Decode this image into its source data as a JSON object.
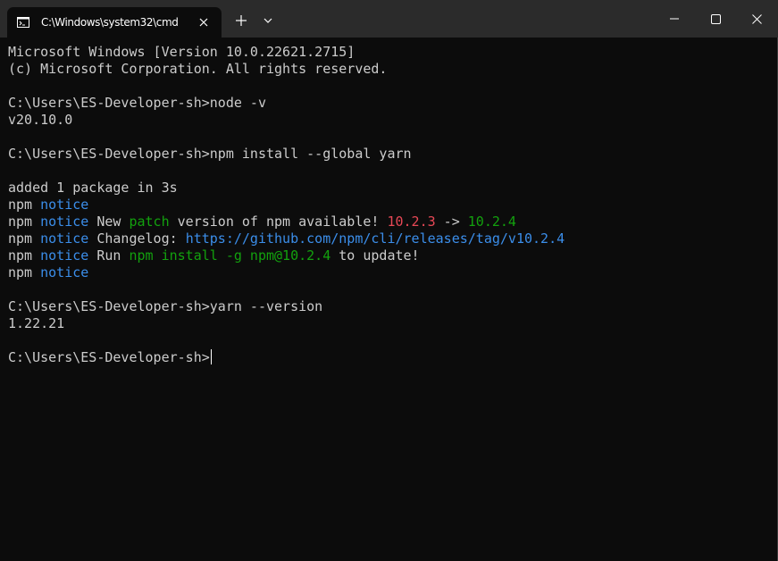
{
  "window": {
    "tab_title": "C:\\Windows\\system32\\cmd",
    "new_tab_label": "+",
    "icons": {
      "tab": "terminal-icon",
      "close_tab": "close-icon",
      "dropdown": "chevron-down-icon",
      "minimize": "minimize-icon",
      "maximize": "maximize-icon",
      "close_window": "close-icon"
    }
  },
  "colors": {
    "background": "#0c0c0c",
    "titlebar": "#2b2b2b",
    "text": "#cccccc",
    "notice_blue": "#3b8eea",
    "highlight_green": "#13a10e",
    "old_version_red": "#e74856"
  },
  "terminal": {
    "lines": [
      [
        {
          "t": "Microsoft Windows [Version 10.0.22621.2715]"
        }
      ],
      [
        {
          "t": "(c) Microsoft Corporation. All rights reserved."
        }
      ],
      [],
      [
        {
          "t": "C:\\Users\\ES-Developer-sh>node -v"
        }
      ],
      [
        {
          "t": "v20.10.0"
        }
      ],
      [],
      [
        {
          "t": "C:\\Users\\ES-Developer-sh>npm install --global yarn"
        }
      ],
      [],
      [
        {
          "t": "added 1 package in 3s"
        }
      ],
      [
        {
          "t": "npm "
        },
        {
          "t": "notice",
          "c": "blue"
        }
      ],
      [
        {
          "t": "npm "
        },
        {
          "t": "notice",
          "c": "blue"
        },
        {
          "t": " New "
        },
        {
          "t": "patch",
          "c": "green"
        },
        {
          "t": " version of npm available! "
        },
        {
          "t": "10.2.3",
          "c": "red"
        },
        {
          "t": " -> "
        },
        {
          "t": "10.2.4",
          "c": "green"
        }
      ],
      [
        {
          "t": "npm "
        },
        {
          "t": "notice",
          "c": "blue"
        },
        {
          "t": " Changelog: "
        },
        {
          "t": "https://github.com/npm/cli/releases/tag/v10.2.4",
          "c": "blue"
        }
      ],
      [
        {
          "t": "npm "
        },
        {
          "t": "notice",
          "c": "blue"
        },
        {
          "t": " Run "
        },
        {
          "t": "npm install -g npm@10.2.4",
          "c": "green"
        },
        {
          "t": " to update!"
        }
      ],
      [
        {
          "t": "npm "
        },
        {
          "t": "notice",
          "c": "blue"
        }
      ],
      [],
      [
        {
          "t": "C:\\Users\\ES-Developer-sh>yarn --version"
        }
      ],
      [
        {
          "t": "1.22.21"
        }
      ],
      [],
      [
        {
          "t": "C:\\Users\\ES-Developer-sh>"
        }
      ]
    ]
  }
}
